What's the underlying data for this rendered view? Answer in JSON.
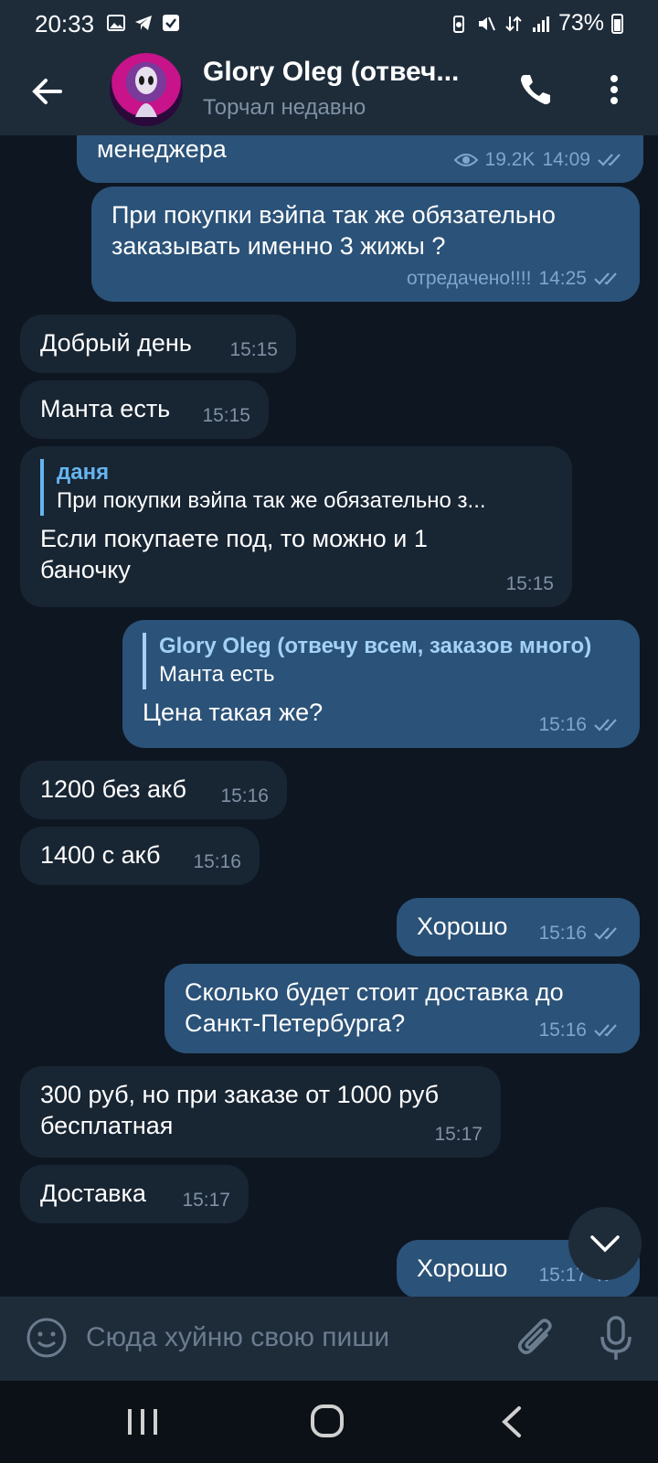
{
  "status_bar": {
    "time": "20:33",
    "battery": "73%"
  },
  "header": {
    "title": "Glory Oleg (отвеч...",
    "subtitle": "Торчал недавно"
  },
  "messages": [
    {
      "dir": "out",
      "text": "менеджера",
      "views": "19.2K",
      "time": "14:09"
    },
    {
      "dir": "out",
      "text": "При покупки вэйпа так же обязательно заказывать именно 3 жижы ?",
      "edited": "отредачено!!!!",
      "time": "14:25"
    },
    {
      "dir": "in",
      "text": "Добрый день",
      "time": "15:15"
    },
    {
      "dir": "in",
      "text": "Манта есть",
      "time": "15:15"
    },
    {
      "dir": "in",
      "reply_name": "даня",
      "reply_text": "При покупки вэйпа так же обязательно з...",
      "text": "Если покупаете под, то можно и 1 баночку",
      "time": "15:15"
    },
    {
      "dir": "out",
      "reply_name": "Glory Oleg (отвечу всем, заказов много)",
      "reply_text": "Манта есть",
      "text": "Цена такая же?",
      "time": "15:16"
    },
    {
      "dir": "in",
      "text": "1200 без акб",
      "time": "15:16"
    },
    {
      "dir": "in",
      "text": "1400 с акб",
      "time": "15:16"
    },
    {
      "dir": "out",
      "text": "Хорошо",
      "time": "15:16"
    },
    {
      "dir": "out",
      "text": "Сколько будет стоит доставка до Санкт-Петербурга?",
      "time": "15:16"
    },
    {
      "dir": "in",
      "text": "300 руб, но при заказе от 1000 руб бесплатная",
      "time": "15:17"
    },
    {
      "dir": "in",
      "text": "Доставка",
      "time": "15:17"
    },
    {
      "dir": "out",
      "text": "Хорошо",
      "time": "15:17"
    }
  ],
  "input": {
    "placeholder": "Сюда хуйню свою пиши"
  },
  "colors": {
    "accent": "#64b5ef",
    "outgoing_bubble": "#2b5278",
    "incoming_bubble": "#182533",
    "background": "#0e1621"
  }
}
